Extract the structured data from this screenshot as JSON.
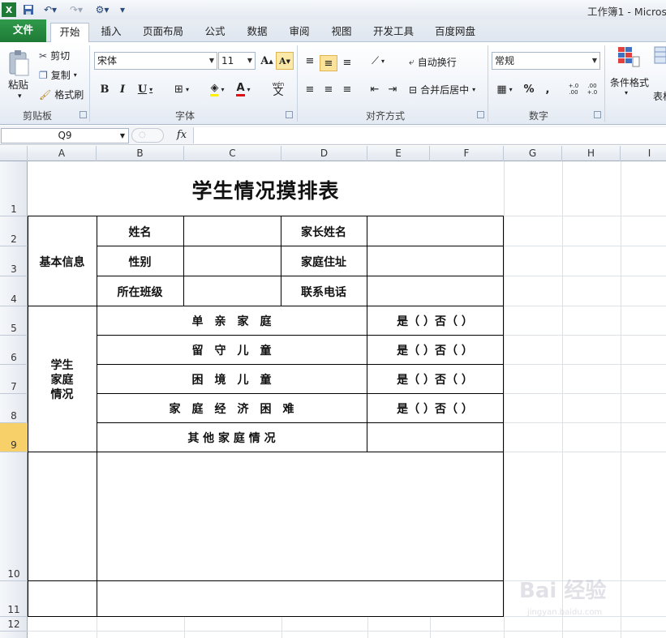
{
  "window": {
    "title": "工作簿1 - Micros"
  },
  "qat": {
    "redo_icon": "redo-icon",
    "customize": "▾"
  },
  "tabs": [
    "文件",
    "开始",
    "插入",
    "页面布局",
    "公式",
    "数据",
    "审阅",
    "视图",
    "开发工具",
    "百度网盘"
  ],
  "ribbon": {
    "clipboard": {
      "paste": "粘贴",
      "cut": "剪切",
      "copy": "复制",
      "format_painter": "格式刷",
      "label": "剪贴板"
    },
    "font": {
      "name": "宋体",
      "size": "11",
      "bold": "B",
      "italic": "I",
      "underline": "U",
      "grow": "A",
      "shrink": "A",
      "color_letter": "A",
      "wen": "wén",
      "wen_char": "文",
      "label": "字体"
    },
    "alignment": {
      "wrap": "自动换行",
      "merge": "合并后居中",
      "label": "对齐方式"
    },
    "number": {
      "format": "常规",
      "percent": "%",
      "comma": ",",
      "inc": "+.0 .00",
      "dec": ".00 +.0",
      "label": "数字"
    },
    "styles": {
      "conditional": "条件格式",
      "table": "表格"
    }
  },
  "formula_bar": {
    "name_box": "Q9",
    "fx": "fx",
    "value": ""
  },
  "columns": [
    "A",
    "B",
    "C",
    "D",
    "E",
    "F",
    "G",
    "H",
    "I"
  ],
  "rows": [
    "1",
    "2",
    "3",
    "4",
    "5",
    "6",
    "7",
    "8",
    "9",
    "10",
    "11",
    "12"
  ],
  "selected_row": "9",
  "sheet": {
    "title": "学生情况摸排表",
    "basic_info": "基本信息",
    "name": "姓名",
    "parent_name": "家长姓名",
    "gender": "性别",
    "address": "家庭住址",
    "class": "所在班级",
    "phone": "联系电话",
    "family_section_line1": "学生",
    "family_section_line2": "家庭",
    "family_section_line3": "情况",
    "items": [
      {
        "label": "单　亲　家　庭",
        "answer": "是（ ）否（ ）"
      },
      {
        "label": "留　守　儿　童",
        "answer": "是（ ）否（ ）"
      },
      {
        "label": "困　境　儿　童",
        "answer": "是（ ）否（ ）"
      },
      {
        "label": "家　庭　经　济　困　难",
        "answer": "是（ ）否（ ）"
      }
    ],
    "other": "其 他 家 庭 情 况"
  },
  "watermark": {
    "text": "Bai 经验",
    "url": "jingyan.baidu.com"
  }
}
